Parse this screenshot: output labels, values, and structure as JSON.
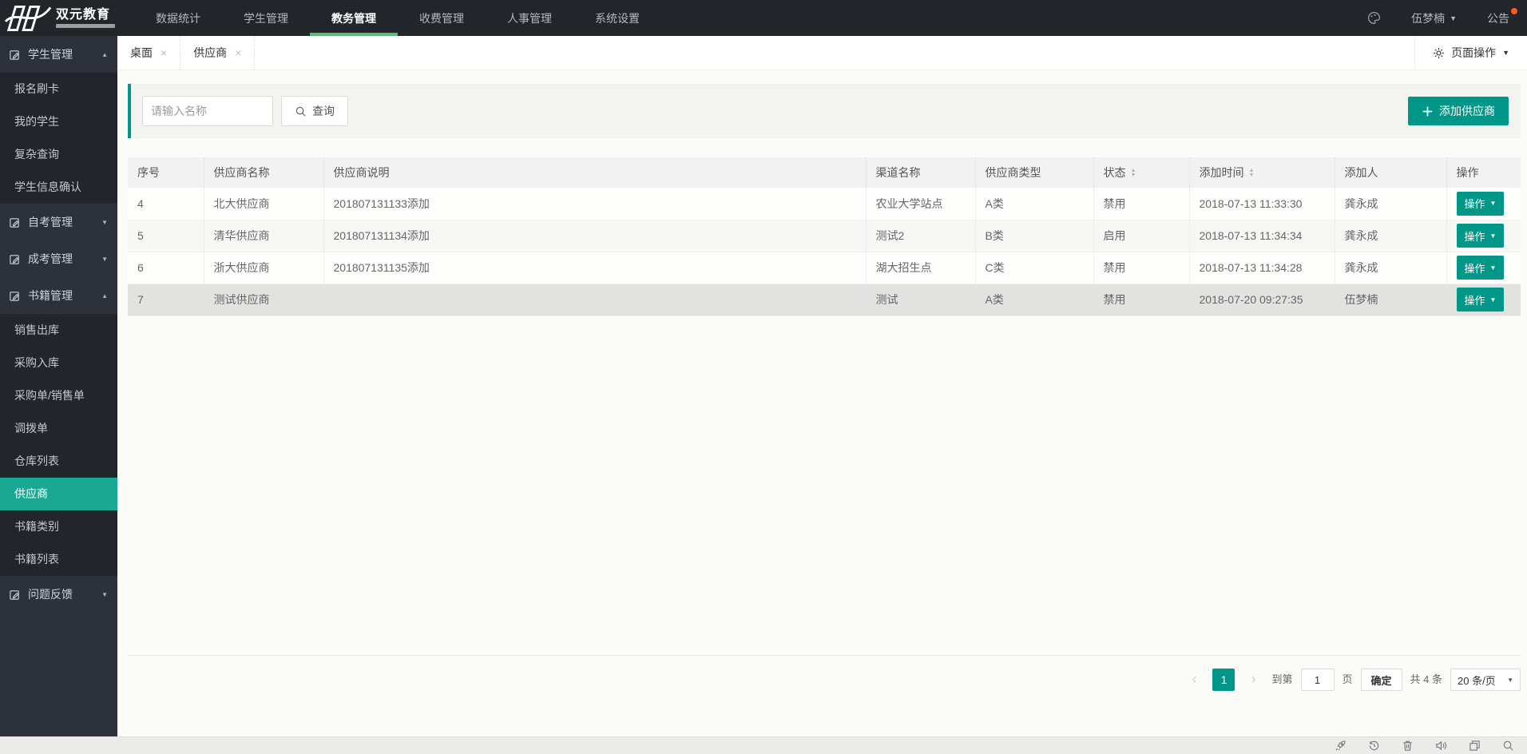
{
  "navbar": {
    "logo_text": "双元教育",
    "menu": [
      {
        "label": "数据统计",
        "active": false
      },
      {
        "label": "学生管理",
        "active": false
      },
      {
        "label": "教务管理",
        "active": true
      },
      {
        "label": "收费管理",
        "active": false
      },
      {
        "label": "人事管理",
        "active": false
      },
      {
        "label": "系统设置",
        "active": false
      }
    ],
    "user": "伍梦楠",
    "notice": "公告"
  },
  "tabs": [
    {
      "label": "桌面"
    },
    {
      "label": "供应商"
    }
  ],
  "page_actions_label": "页面操作",
  "sidebar": {
    "groups": [
      {
        "label": "学生管理",
        "expanded": true,
        "children": [
          "报名刷卡",
          "我的学生",
          "复杂查询",
          "学生信息确认"
        ]
      },
      {
        "label": "自考管理",
        "expanded": false,
        "children": []
      },
      {
        "label": "成考管理",
        "expanded": false,
        "children": []
      },
      {
        "label": "书籍管理",
        "expanded": true,
        "active_child": "供应商",
        "children": [
          "销售出库",
          "采购入库",
          "采购单/销售单",
          "调拨单",
          "仓库列表",
          "供应商",
          "书籍类别",
          "书籍列表"
        ]
      },
      {
        "label": "问题反馈",
        "expanded": false,
        "children": []
      }
    ]
  },
  "filter": {
    "placeholder": "请输入名称",
    "search_label": "查询",
    "add_label": "添加供应商"
  },
  "table": {
    "headers": [
      "序号",
      "供应商名称",
      "供应商说明",
      "渠道名称",
      "供应商类型",
      "状态",
      "添加时间",
      "添加人",
      "操作"
    ],
    "action_label": "操作",
    "rows": [
      {
        "seq": "4",
        "name": "北大供应商",
        "desc": "201807131133添加",
        "channel": "农业大学站点",
        "type": "A类",
        "status": "禁用",
        "time": "2018-07-13 11:33:30",
        "adder": "龚永成"
      },
      {
        "seq": "5",
        "name": "清华供应商",
        "desc": "201807131134添加",
        "channel": "测试2",
        "type": "B类",
        "status": "启用",
        "time": "2018-07-13 11:34:34",
        "adder": "龚永成"
      },
      {
        "seq": "6",
        "name": "浙大供应商",
        "desc": "201807131135添加",
        "channel": "湖大招生点",
        "type": "C类",
        "status": "禁用",
        "time": "2018-07-13 11:34:28",
        "adder": "龚永成"
      },
      {
        "seq": "7",
        "name": "测试供应商",
        "desc": "",
        "channel": "测试",
        "type": "A类",
        "status": "禁用",
        "time": "2018-07-20 09:27:35",
        "adder": "伍梦楠"
      }
    ]
  },
  "pagination": {
    "current": "1",
    "goto_label": "到第",
    "goto_value": "1",
    "page_label": "页",
    "confirm_label": "确定",
    "total_label": "共 4 条",
    "per_page": "20 条/页"
  },
  "icons": {
    "close": "×",
    "caret_down": "▼",
    "caret_up": "▲",
    "sort_up": "▲",
    "sort_down": "▼",
    "plus": "＋",
    "prev": "‹",
    "next": "›"
  },
  "colors": {
    "accent": "#009688",
    "sidebar_active": "#19a893",
    "nav_active_underline": "#5FB878",
    "status_disabled": "#ff5722",
    "status_enabled": "#009688"
  }
}
